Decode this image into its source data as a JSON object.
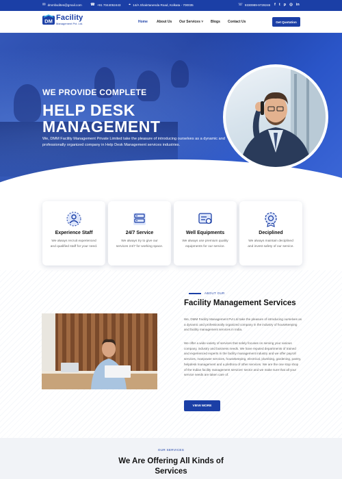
{
  "topbar": {
    "email": "dmmfaciltes@gmail.com",
    "phone": "+91 7044052443",
    "address": "14/A Shakrtanenda Road, Kolkata - 700035",
    "phone2": "9330989-9728246",
    "social": [
      "f",
      "t",
      "p",
      "in",
      "in"
    ]
  },
  "nav": {
    "logo_main": "Facility",
    "logo_sub": "Management Pvt. Ltd.",
    "logo_mark": "DM",
    "menu": [
      "Home",
      "About Us",
      "Our Services ˅",
      "Blogs",
      "Contact Us"
    ],
    "quote_button": "Get Quotation"
  },
  "hero": {
    "subtitle": "WE PROVIDE COMPLETE",
    "title_line1": "HELP DESK",
    "title_line2": "MANAGEMENT",
    "description": "We, DMM Facility Management Private Limited take the pleasure of introducing ourselves as a dynamic and professionally organized company in Help Desk Management services industries."
  },
  "features": [
    {
      "title": "Experience Staff",
      "desc": "We always recruit experienced and qualified staff for your need."
    },
    {
      "title": "24/7 Service",
      "desc": "We always try to give our services 24/7 for working space."
    },
    {
      "title": "Well Equipments",
      "desc": "We always use premium quality equipments for our service."
    },
    {
      "title": "Deciplined",
      "desc": "We always maintain deciplined and invest safety of our service."
    }
  ],
  "about": {
    "tag": "ABOUT OUR",
    "title": "Facility Management Services",
    "para1": "We, DMM Facility Management Pvt Ltd take the pleasure of introducing ourselves as a dynamic and professionally organized company in the industry of housekeeping and facility management services in India.",
    "para2": "We offer a wide variety of services that solely focuses on serving your various company, industry and business needs. We have reputed departments of trained and experienced experts in the facility management industry and we offer payroll services, manpower services, housekeeping, electrical, plumbing, gardening, pantry, helpdesk management and a plethora of other services. We are the one stop shop of the Indian facility management services' sector and we make sure that all your service needs are taken care of.",
    "button": "VIEW MORE"
  },
  "services": {
    "tag": "OUR SERVICES",
    "title": "We Are Offering All Kinds of Services"
  },
  "colors": {
    "brand": "#1b3fa6",
    "hero_blue": "#2a55c8"
  }
}
